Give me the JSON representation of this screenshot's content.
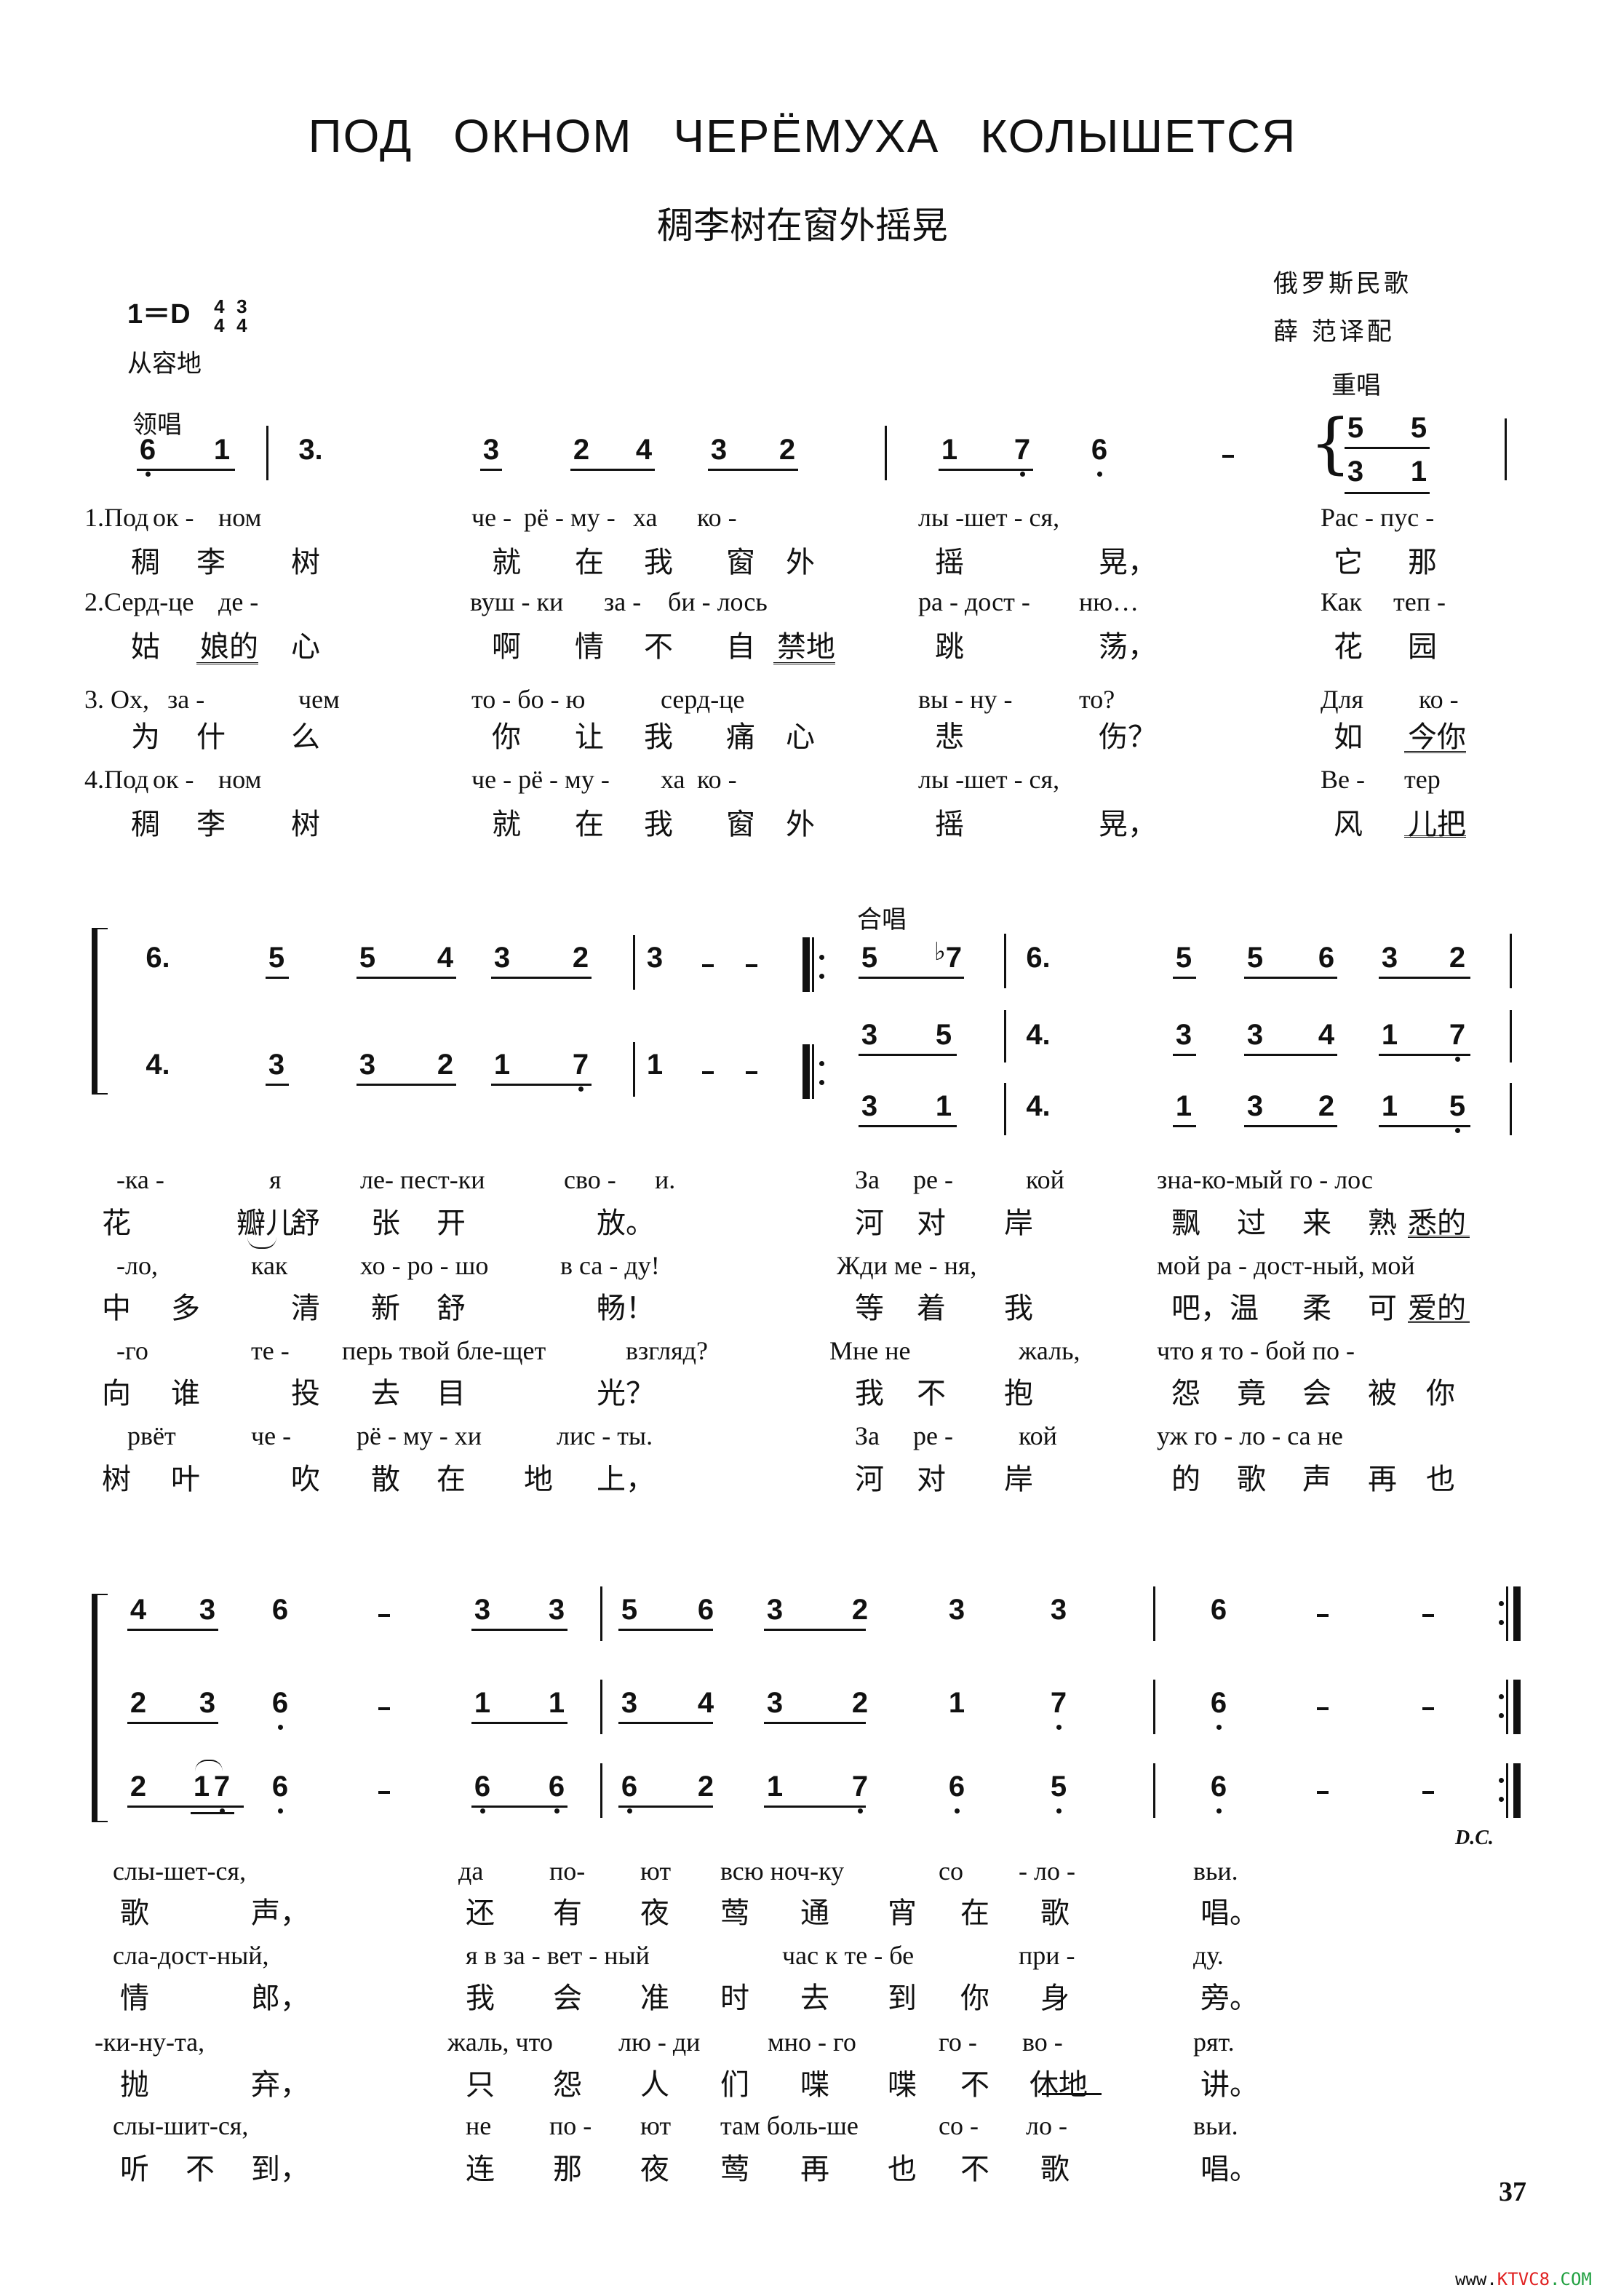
{
  "title": "ПОД ОКНОМ ЧЕРЁМУХА КОЛЫШЕТСЯ",
  "subtitle": "稠李树在窗外摇晃",
  "credits": {
    "origin": "俄罗斯民歌",
    "translator": "薛 范译配"
  },
  "key": "1＝D",
  "time_signatures": [
    {
      "num": "4",
      "den": "4"
    },
    {
      "num": "3",
      "den": "4"
    }
  ],
  "tempo": "从容地",
  "parts": {
    "lead": "领唱",
    "duet": "重唱",
    "chorus": "合唱"
  },
  "systems": [
    {
      "id": "system-1",
      "voices": [
        {
          "name": "lead",
          "measures": [
            "6̣ 1 (pickup)",
            "3. 3 24 32",
            "1 7̣ 6̣ -",
            "5 5 / 3 1 (duet)"
          ]
        }
      ],
      "lyrics": [
        {
          "verse": "1.",
          "ru": [
            "1.Под",
            "ок -",
            "ном",
            "че -",
            "рё - му -",
            "ха",
            "ко -",
            "лы -шет - ся,",
            "Рас - пус -"
          ],
          "zh": [
            "稠",
            "李",
            "树",
            "就",
            "在",
            "我",
            "窗",
            "外",
            "摇",
            "晃，",
            "它",
            "那"
          ]
        },
        {
          "verse": "2.",
          "ru": [
            "2.Серд-це",
            "де -",
            "вуш - ки",
            "за -",
            "би - лось",
            "ра - дост -",
            "ню…",
            "Как",
            "теп -"
          ],
          "zh": [
            "姑",
            "娘的",
            "心",
            "啊",
            "情",
            "不",
            "自",
            "禁地",
            "跳",
            "荡，",
            "花",
            "园"
          ]
        },
        {
          "verse": "3.",
          "ru": [
            "3. Ох,",
            "за -",
            "чем",
            "то - бо - ю",
            "серд-це",
            "вы - ну -",
            "то?",
            "Для",
            "ко -"
          ],
          "zh": [
            "为",
            "什",
            "么",
            "你",
            "让",
            "我",
            "痛",
            "心",
            "悲",
            "伤？",
            "如",
            "今你"
          ]
        },
        {
          "verse": "4.",
          "ru": [
            "4.Под",
            "ок -",
            "ном",
            "че - рё - му -",
            "ха",
            "ко -",
            "лы -шет - ся,",
            "Ве -",
            "тер"
          ],
          "zh": [
            "稠",
            "李",
            "树",
            "就",
            "在",
            "我",
            "窗",
            "外",
            "摇",
            "晃，",
            "风",
            "儿把"
          ]
        }
      ]
    },
    {
      "id": "system-2",
      "voices": [
        {
          "name": "upper",
          "measures": [
            "6. 5 54 32",
            "3 - -",
            "5 ♭7",
            "6. 5 56 32"
          ]
        },
        {
          "name": "middle",
          "measures": [
            "4. 3 32 17̣",
            "1 - -",
            "3 5",
            "4. 3 34 17̣"
          ]
        },
        {
          "name": "lower",
          "measures": [
            "3 1",
            "4. 1 32 15̣"
          ]
        }
      ],
      "lyrics": [
        {
          "ru": "-ка - я ле- пест-ки сво - и. За ре - кой зна-ко-мый го - лос",
          "zh": "花 瓣儿 舒 张 开 放。 河 对 岸 飘 过 来 熟 悉的"
        },
        {
          "ru": "-ло, как хо - ро - шо в са - ду! Жди ме - ня, мой ра - дост-ный, мой",
          "zh": "中 多 清 新 舒 畅！ 等 着 我 吧，温 柔 可 爱的"
        },
        {
          "ru": "-го те - перь твой бле-щет взгляд? Мне не жаль, что я то - бой по -",
          "zh": "向 谁 投 去 目 光？ 我 不 抱 怨 竟 会 被 你"
        },
        {
          "ru": "рвёт че - рё - му - хи лис - ты. За ре - кой уж го - ло - са не",
          "zh": "树 叶 吹 散 在 地 上， 河 对 岸 的 歌 声 再 也"
        }
      ]
    },
    {
      "id": "system-3",
      "voices": [
        {
          "name": "upper",
          "measures": [
            "43 6 - 33",
            "56 32 3 3",
            "6 - -"
          ]
        },
        {
          "name": "middle",
          "measures": [
            "23 6̣ - 11",
            "34 32 1 7̣",
            "6̣ - -"
          ]
        },
        {
          "name": "lower",
          "measures": [
            "2 1̣7̣ 6̣ - 6̣6̣",
            "6̣2 17̣ 6̣ 5̣",
            "6̣ - -"
          ]
        }
      ],
      "ending": "D.C.",
      "lyrics": [
        {
          "ru": "слы-шет-ся, да по- ют всю ноч-ку со - ло - вьи.",
          "zh": "歌 声， 还 有 夜 莺 通 宵 在 歌 唱。"
        },
        {
          "ru": "сла-дост-ный, я в за - вет - ный час к те - бе при - ду.",
          "zh": "情 郎， 我 会 准 时 去 到 你 身 旁。"
        },
        {
          "ru": "-ки-ну-та, жаль, что лю - ди мно - го го - во - рят.",
          "zh": "抛 弃， 只 怨 人 们 喋 喋 不 休地 讲。"
        },
        {
          "ru": "слы-шит-ся, не по - ют там боль-ше со - ло - вьи.",
          "zh": "听 不 到， 连 那 夜 莺 再 也 不 歌 唱。"
        }
      ]
    }
  ],
  "page_number": "37",
  "watermark": {
    "prefix": "www.",
    "brand": "KTVC8",
    "suffix": ".COM",
    "colors": {
      "prefix": "#111111",
      "brand": "#e02020",
      "eight": "#2040d0",
      "suffix": "#20a040"
    }
  },
  "render": {
    "s1_notes": [
      [
        "6",
        188,
        "dotb"
      ],
      [
        "1",
        290,
        ""
      ],
      [
        "3.",
        405,
        ""
      ],
      [
        "3",
        660,
        "ul"
      ],
      [
        "2",
        784,
        ""
      ],
      [
        "4",
        870,
        ""
      ],
      [
        "3",
        973,
        ""
      ],
      [
        "2",
        1067,
        ""
      ],
      [
        "1",
        1290,
        ""
      ],
      [
        "7",
        1390,
        "dotb"
      ],
      [
        "6",
        1496,
        "dotb"
      ],
      [
        "5",
        1848,
        ""
      ],
      [
        "5",
        1935,
        ""
      ],
      [
        "3",
        1848,
        "low"
      ],
      [
        "1",
        1935,
        "low"
      ]
    ],
    "s1_ru": [
      [
        [
          116,
          "1.Под"
        ],
        [
          210,
          "ок -"
        ],
        [
          300,
          "ном"
        ],
        [
          648,
          "че -"
        ],
        [
          720,
          "рё - му -"
        ],
        [
          870,
          "ха"
        ],
        [
          958,
          "ко -"
        ],
        [
          1262,
          "лы -шет - ся,"
        ],
        [
          1815,
          "Рас - пус -"
        ]
      ],
      [
        [
          116,
          "2.Серд-це"
        ],
        [
          300,
          "де -"
        ],
        [
          646,
          "вуш - ки"
        ],
        [
          830,
          "за -"
        ],
        [
          918,
          "би - лось"
        ],
        [
          1262,
          "ра - дост -"
        ],
        [
          1483,
          "ню…"
        ],
        [
          1815,
          "Как"
        ],
        [
          1915,
          "теп -"
        ]
      ],
      [
        [
          116,
          "3. Ох,"
        ],
        [
          230,
          "за -"
        ],
        [
          410,
          "чем"
        ],
        [
          648,
          "то - бо - ю"
        ],
        [
          908,
          "серд-це"
        ],
        [
          1262,
          "вы - ну -"
        ],
        [
          1483,
          "то?"
        ],
        [
          1815,
          "Для"
        ],
        [
          1950,
          "ко -"
        ]
      ],
      [
        [
          116,
          "4.Под"
        ],
        [
          210,
          "ок -"
        ],
        [
          300,
          "ном"
        ],
        [
          648,
          "че - рё - му -"
        ],
        [
          908,
          "ха"
        ],
        [
          958,
          "ко -"
        ],
        [
          1262,
          "лы -шет - ся,"
        ],
        [
          1815,
          "Ве -"
        ],
        [
          1930,
          "тер"
        ]
      ]
    ],
    "s1_zh": [
      [
        [
          180,
          "稠"
        ],
        [
          270,
          "李"
        ],
        [
          400,
          "树"
        ],
        [
          676,
          "就"
        ],
        [
          790,
          "在"
        ],
        [
          885,
          "我"
        ],
        [
          998,
          "窗"
        ],
        [
          1080,
          "外"
        ],
        [
          1285,
          "摇"
        ],
        [
          1510,
          "晃，"
        ],
        [
          1833,
          "它"
        ],
        [
          1935,
          "那"
        ]
      ],
      [
        [
          180,
          "姑"
        ],
        [
          275,
          "娘的"
        ],
        [
          400,
          "心"
        ],
        [
          676,
          "啊"
        ],
        [
          790,
          "情"
        ],
        [
          885,
          "不"
        ],
        [
          998,
          "自"
        ],
        [
          1068,
          "禁地"
        ],
        [
          1285,
          "跳"
        ],
        [
          1510,
          "荡，"
        ],
        [
          1833,
          "花"
        ],
        [
          1935,
          "园"
        ]
      ],
      [
        [
          180,
          "为"
        ],
        [
          270,
          "什"
        ],
        [
          400,
          "么"
        ],
        [
          676,
          "你"
        ],
        [
          790,
          "让"
        ],
        [
          885,
          "我"
        ],
        [
          998,
          "痛"
        ],
        [
          1080,
          "心"
        ],
        [
          1285,
          "悲"
        ],
        [
          1510,
          "伤？"
        ],
        [
          1833,
          "如"
        ],
        [
          1935,
          "今你"
        ]
      ],
      [
        [
          180,
          "稠"
        ],
        [
          270,
          "李"
        ],
        [
          400,
          "树"
        ],
        [
          676,
          "就"
        ],
        [
          790,
          "在"
        ],
        [
          885,
          "我"
        ],
        [
          998,
          "窗"
        ],
        [
          1080,
          "外"
        ],
        [
          1285,
          "摇"
        ],
        [
          1510,
          "晃，"
        ],
        [
          1833,
          "风"
        ],
        [
          1935,
          "儿把"
        ]
      ]
    ]
  }
}
